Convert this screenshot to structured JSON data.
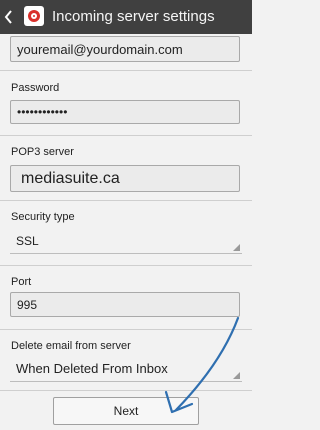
{
  "header": {
    "title": "Incoming server settings",
    "back_icon": "chevron-left-icon",
    "app_icon": "email-app-icon"
  },
  "form": {
    "username_value": "youremail@yourdomain.com",
    "password_label": "Password",
    "password_value": "••••••••••••",
    "server_label": "POP3 server",
    "server_value": "mediasuite.ca",
    "security_label": "Security type",
    "security_value": "SSL",
    "port_label": "Port",
    "port_value": "995",
    "delete_label": "Delete email from server",
    "delete_value": "When Deleted From Inbox"
  },
  "footer": {
    "next_label": "Next"
  },
  "colors": {
    "topbar": "#404040",
    "accent_arrow": "#2f6fb0",
    "app_icon_red": "#d9302b"
  }
}
